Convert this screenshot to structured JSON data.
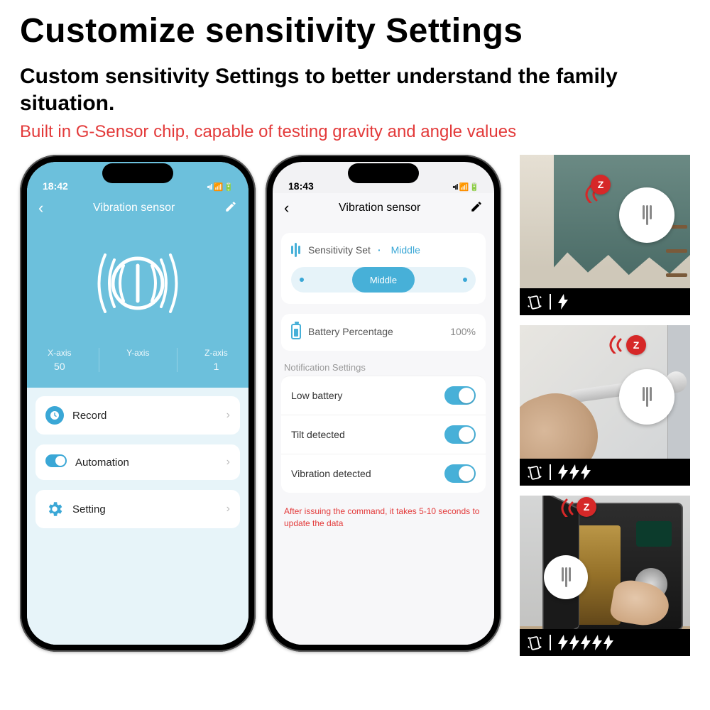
{
  "headline": "Customize sensitivity Settings",
  "subhead": "Custom sensitivity Settings to better understand the family situation.",
  "redline": "Built in G-Sensor chip, capable of testing gravity and angle values",
  "phone1": {
    "time": "18:42",
    "status_right": "📶 📡 🔋",
    "title": "Vibration sensor",
    "axes": {
      "x_label": "X-axis",
      "x_val": "50",
      "y_label": "Y-axis",
      "y_val": "",
      "z_label": "Z-axis",
      "z_val": "1"
    },
    "rows": {
      "record": "Record",
      "automation": "Automation",
      "setting": "Setting"
    }
  },
  "phone2": {
    "time": "18:43",
    "status_right": "📶 📡 🔋",
    "title": "Vibration sensor",
    "sensitivity_label": "Sensitivity Set",
    "sensitivity_value": "Middle",
    "slider_value": "Middle",
    "battery_label": "Battery Percentage",
    "battery_value": "100%",
    "notif_title": "Notification Settings",
    "notif_low": "Low battery",
    "notif_tilt": "Tilt detected",
    "notif_vib": "Vibration detected",
    "note": "After issuing the command, it takes 5-10 seconds to update the data"
  },
  "zlogo": "Z"
}
